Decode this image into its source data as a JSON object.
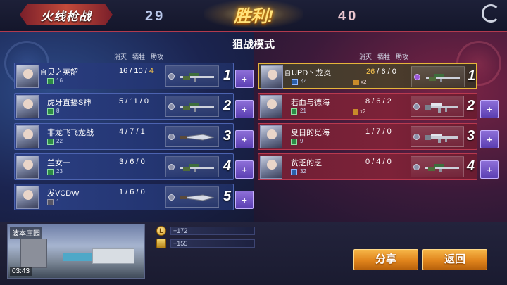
{
  "header": {
    "logo_text": "火线枪战",
    "blue_score": "29",
    "red_score": "40",
    "result": "胜利!"
  },
  "mode_title": "狙战模式",
  "columns": {
    "kills": "消灭",
    "deaths": "牺牲",
    "assists": "助攻"
  },
  "blue_team": [
    {
      "name": "贝之英韶",
      "level": "16",
      "k": "16",
      "d": "10",
      "a": "4",
      "rank": "1",
      "weapon": "sniper"
    },
    {
      "name": "虎牙直播S神",
      "level": "8",
      "k": "5",
      "d": "11",
      "a": "0",
      "rank": "2",
      "weapon": "sniper"
    },
    {
      "name": "非龙飞飞龙战",
      "level": "22",
      "k": "4",
      "d": "7",
      "a": "1",
      "rank": "3",
      "weapon": "knife"
    },
    {
      "name": "兰女一",
      "level": "23",
      "k": "3",
      "d": "6",
      "a": "0",
      "rank": "4",
      "weapon": "sniper"
    },
    {
      "name": "发VCDvv",
      "level": "1",
      "k": "1",
      "d": "6",
      "a": "0",
      "rank": "5",
      "weapon": "knife"
    }
  ],
  "red_team": [
    {
      "name": "UPD丶龙炎",
      "level": "44",
      "k": "26",
      "d": "6",
      "a": "0",
      "rank": "1",
      "weapon": "sniper",
      "x2": "x2",
      "tag": "自"
    },
    {
      "name": "若血与德海",
      "level": "21",
      "k": "8",
      "d": "6",
      "a": "2",
      "rank": "2",
      "weapon": "rifle",
      "x2": "x2"
    },
    {
      "name": "夏日的觅海",
      "level": "9",
      "k": "1",
      "d": "7",
      "a": "0",
      "rank": "3",
      "weapon": "rifle"
    },
    {
      "name": "贫乏的乏",
      "level": "32",
      "k": "0",
      "d": "4",
      "a": "0",
      "rank": "4",
      "weapon": "sniper"
    }
  ],
  "blue_first_tag": "自",
  "bottom": {
    "map_name": "波本庄园",
    "time": "03:43",
    "reward_coin": "+172",
    "reward_rank": "+155",
    "share_label": "分享",
    "back_label": "返回"
  },
  "colors": {
    "blue_row": "#2b3f83",
    "red_row": "#7c2238",
    "gold": "#f6c24a",
    "button": "#e0841c"
  },
  "icons": {
    "reload": "reload-icon",
    "add_friend": "add-friend-icon",
    "coin": "gold-coin-icon",
    "rank": "rank-insignia-icon"
  }
}
